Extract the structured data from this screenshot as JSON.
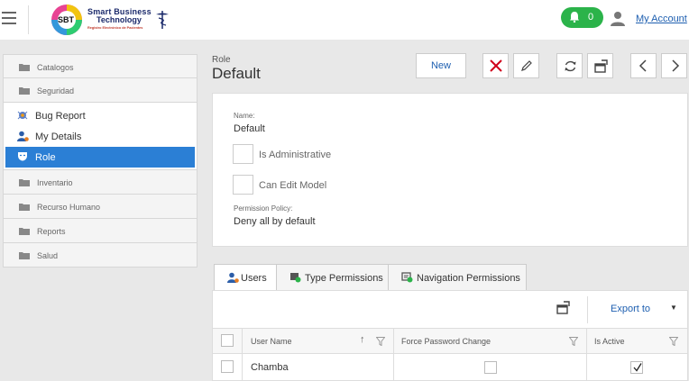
{
  "header": {
    "logo": {
      "line1": "Smart Business",
      "line2": "Technology",
      "tagline": "Registro Electrónico de Pacientes",
      "initials": "SBT"
    },
    "notifications_count": "0",
    "account_label": "My Account"
  },
  "sidebar": {
    "groups_top": [
      {
        "label": "Catalogos",
        "icon": "folder-icon"
      },
      {
        "label": "Seguridad",
        "icon": "folder-icon"
      }
    ],
    "items": [
      {
        "label": "Bug Report",
        "icon": "bug-icon"
      },
      {
        "label": "My Details",
        "icon": "user-details-icon"
      },
      {
        "label": "Role",
        "icon": "mask-icon",
        "active": true
      }
    ],
    "groups_bottom": [
      {
        "label": "Inventario",
        "icon": "folder-icon"
      },
      {
        "label": "Recurso Humano",
        "icon": "folder-icon"
      },
      {
        "label": "Reports",
        "icon": "folder-icon"
      },
      {
        "label": "Salud",
        "icon": "folder-icon"
      }
    ]
  },
  "page": {
    "type_label": "Role",
    "title": "Default"
  },
  "toolbar": {
    "new_label": "New"
  },
  "detail": {
    "name_label": "Name:",
    "name_value": "Default",
    "is_admin_label": "Is Administrative",
    "can_edit_label": "Can Edit Model",
    "policy_label": "Permission Policy:",
    "policy_value": "Deny all by default"
  },
  "tabs": [
    {
      "label": "Users"
    },
    {
      "label": "Type Permissions"
    },
    {
      "label": "Navigation Permissions"
    }
  ],
  "grid": {
    "export_label": "Export to",
    "columns": [
      "User Name",
      "Force Password Change",
      "Is Active"
    ],
    "rows": [
      {
        "user_name": "Chamba",
        "force_password_change": false,
        "is_active": true
      }
    ]
  },
  "colors": {
    "accent": "#2b7fd5",
    "notif": "#2bb34a",
    "delete": "#d0021b",
    "link": "#1e5fb0"
  }
}
